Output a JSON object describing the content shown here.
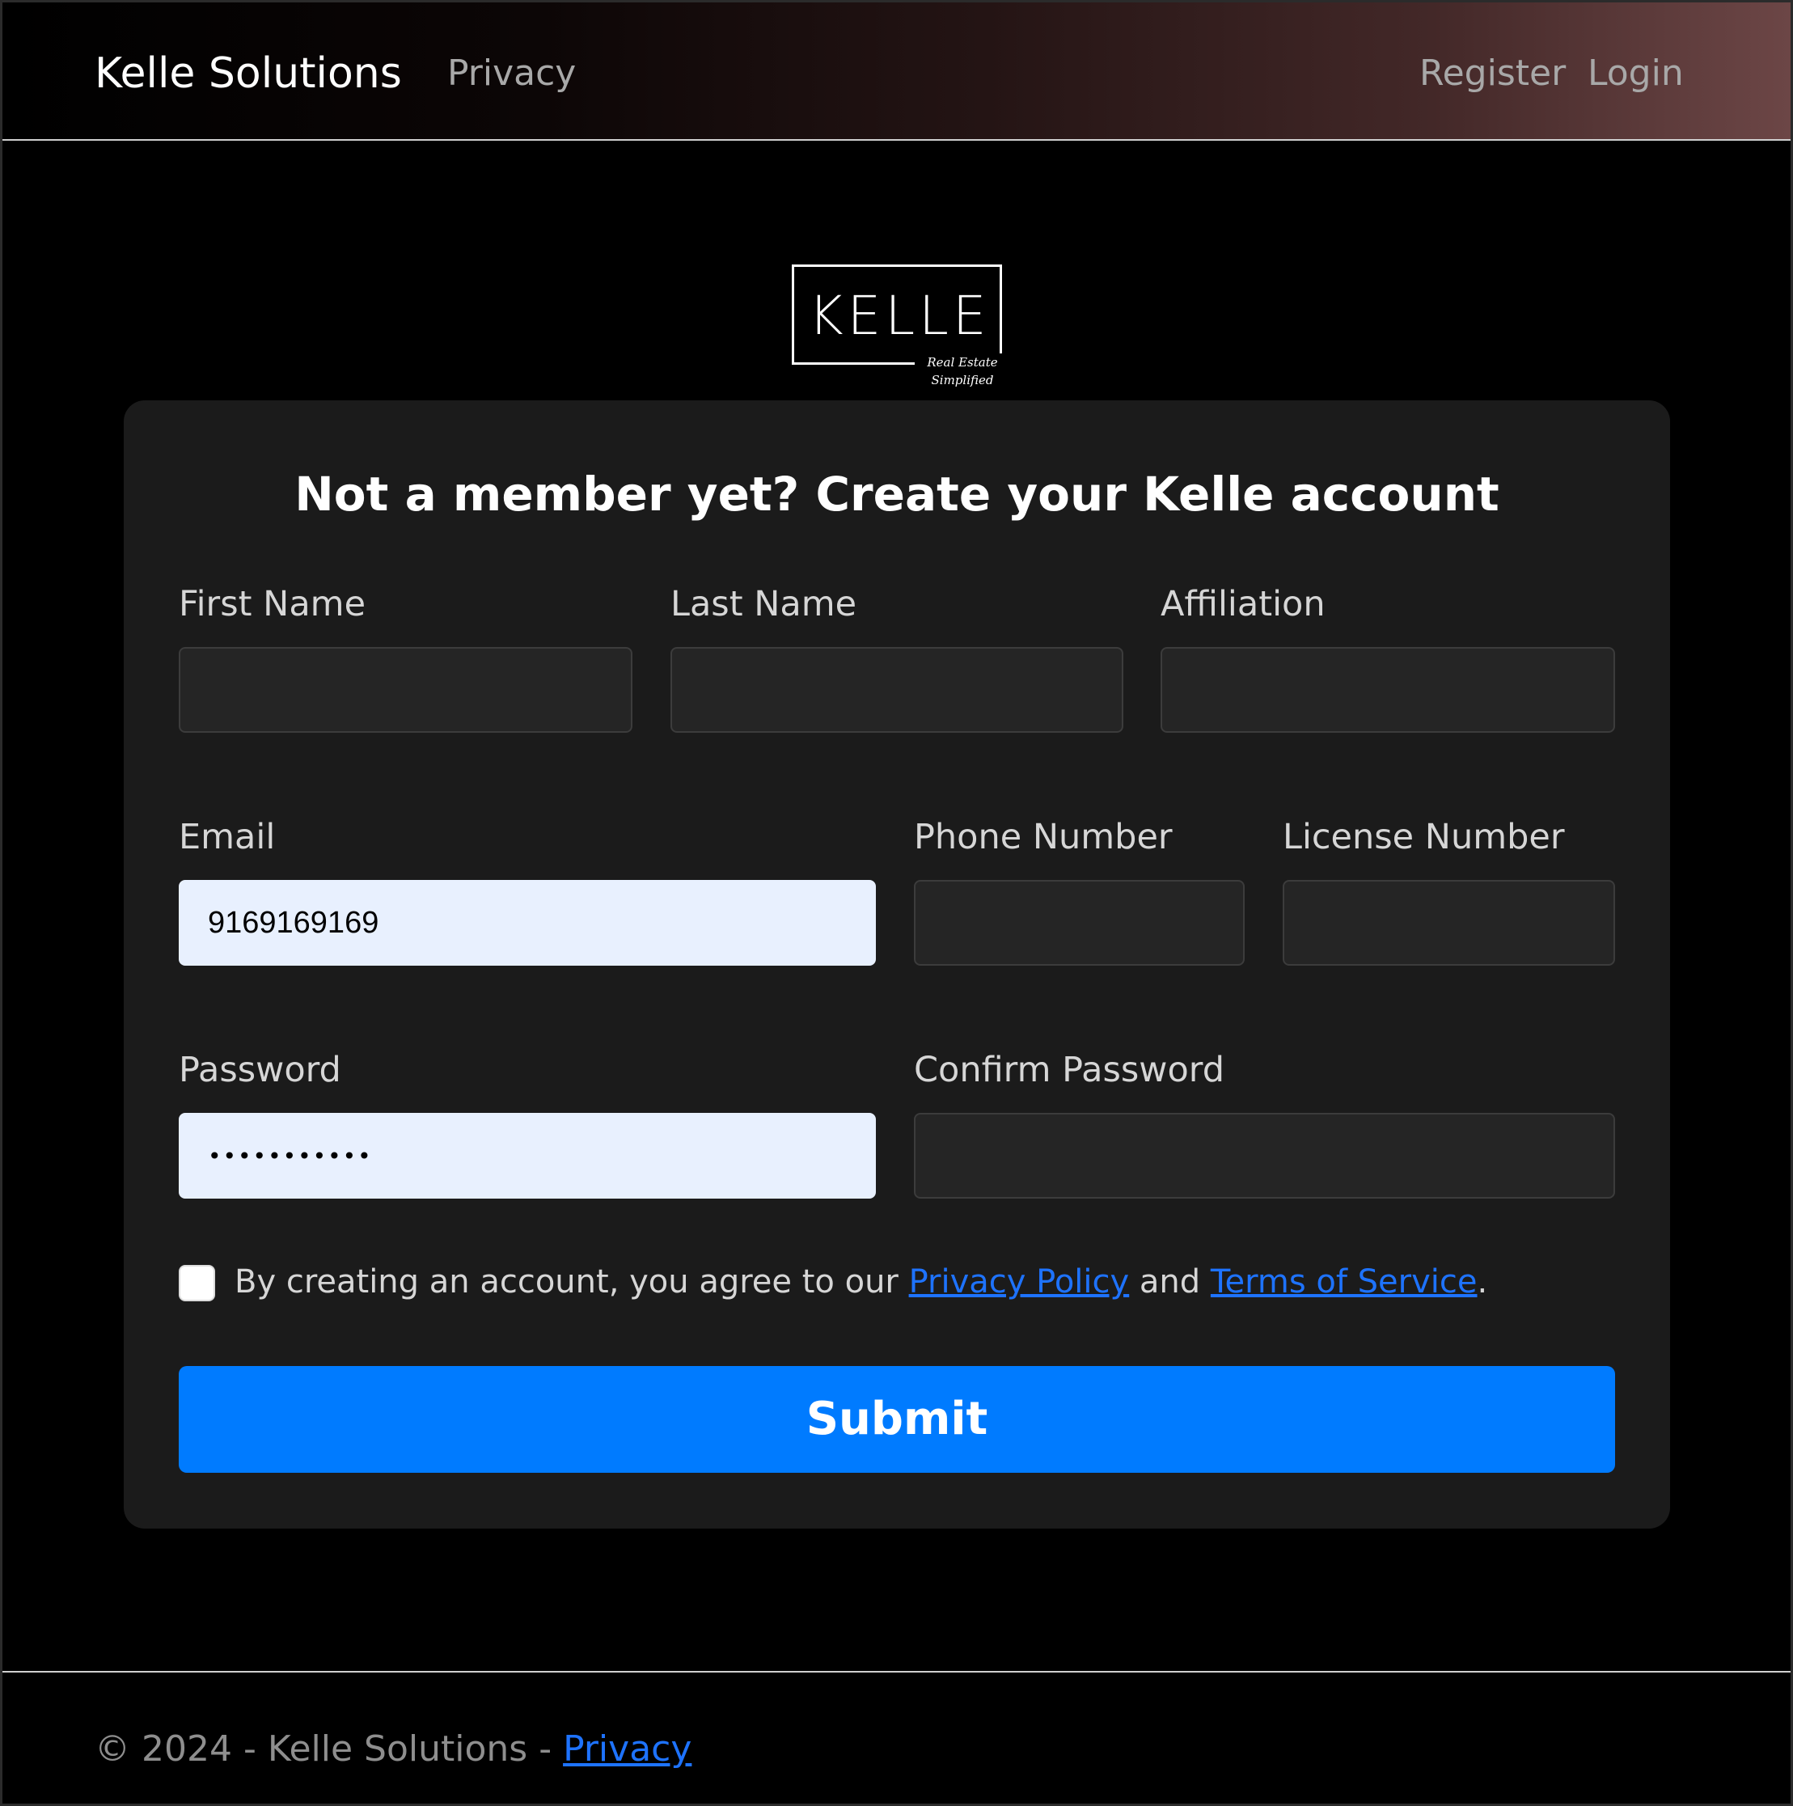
{
  "navbar": {
    "brand": "Kelle Solutions",
    "privacy_label": "Privacy",
    "register_label": "Register",
    "login_label": "Login"
  },
  "logo": {
    "wordmark": "KELLE",
    "tagline_line1": "Real Estate",
    "tagline_line2": "Simplified"
  },
  "form": {
    "title": "Not a member yet? Create your Kelle account",
    "fields": {
      "first_name": {
        "label": "First Name",
        "value": ""
      },
      "last_name": {
        "label": "Last Name",
        "value": ""
      },
      "affiliation": {
        "label": "Affiliation",
        "value": ""
      },
      "email": {
        "label": "Email",
        "value": "9169169169"
      },
      "phone": {
        "label": "Phone Number",
        "value": ""
      },
      "license": {
        "label": "License Number",
        "value": ""
      },
      "password": {
        "label": "Password",
        "value": "•••••••••••"
      },
      "confirm_password": {
        "label": "Confirm Password",
        "value": ""
      }
    },
    "agreement": {
      "checked": false,
      "prefix": "By creating an account, you agree to our ",
      "privacy_link": "Privacy Policy",
      "middle": " and ",
      "terms_link": "Terms of Service",
      "suffix": "."
    },
    "submit_label": "Submit"
  },
  "footer": {
    "text": "© 2024 - Kelle Solutions - ",
    "privacy_link": "Privacy"
  },
  "colors": {
    "background": "#000000",
    "card": "#1b1b1b",
    "accent": "#007bff",
    "link": "#1e73ff",
    "autofill": "#e8f0fe"
  }
}
